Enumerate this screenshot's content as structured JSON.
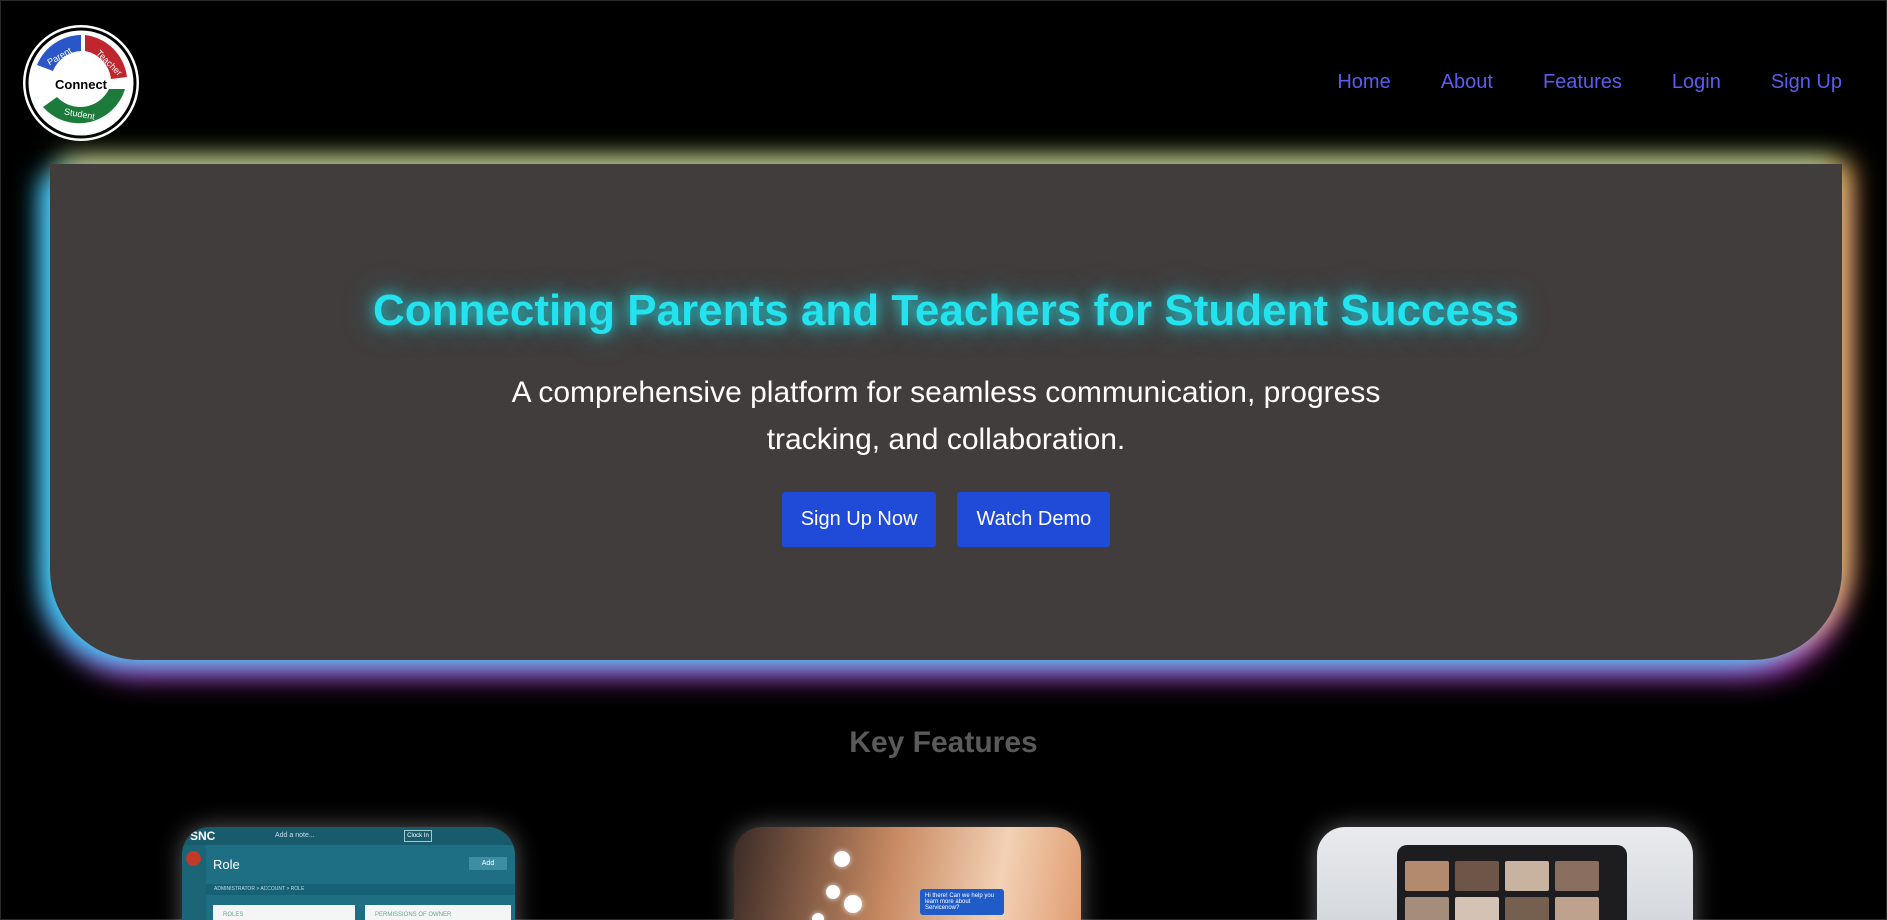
{
  "header": {
    "logo_text": {
      "center": "Connect",
      "parent": "Parent",
      "teacher": "Teacher",
      "student": "Student"
    },
    "nav": [
      {
        "label": "Home"
      },
      {
        "label": "About"
      },
      {
        "label": "Features"
      },
      {
        "label": "Login"
      },
      {
        "label": "Sign Up"
      }
    ]
  },
  "hero": {
    "title": "Connecting Parents and Teachers for Student Success",
    "subtitle": "A comprehensive platform for seamless communication, progress tracking, and collaboration.",
    "buttons": {
      "signup": "Sign Up Now",
      "demo": "Watch Demo"
    }
  },
  "features": {
    "title": "Key Features",
    "card1": {
      "app_logo": "SNC",
      "search": "Add a note...",
      "clock_btn": "Clock In",
      "page_title": "Role",
      "add_btn": "Add",
      "breadcrumb": "ADMINISTRATOR  >  ACCOUNT  >  ROLE",
      "panel1": "ROLES",
      "panel2": "PERMISSIONS OF OWNER"
    },
    "card2": {
      "chat_text": "Hi there! Can we help you learn more about Servicenow?"
    }
  },
  "colors": {
    "background": "#000000",
    "nav_link": "#5a5cf0",
    "hero_bg": "#413d3d",
    "hero_title": "#22e3ee",
    "button": "#1f4bd8",
    "features_title": "#5a5a5a"
  }
}
